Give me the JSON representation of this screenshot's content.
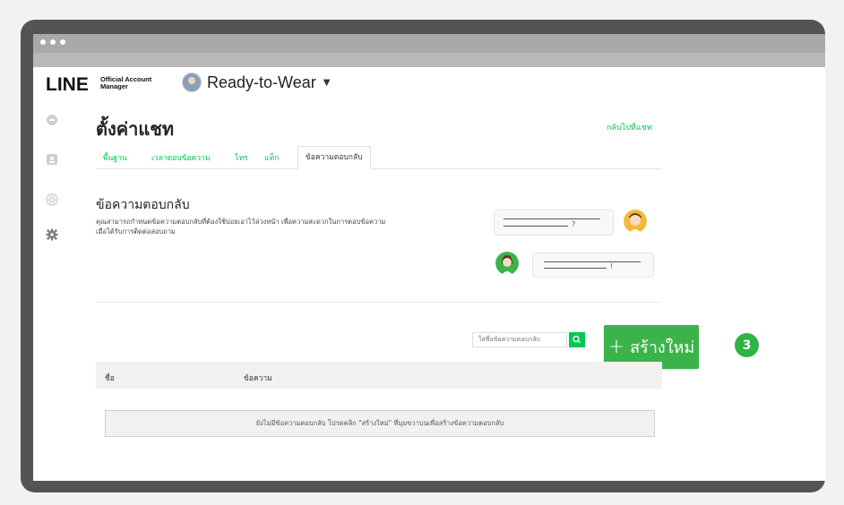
{
  "brand": {
    "line": "LINE",
    "oa_line1": "Official Account",
    "oa_line2": "Manager",
    "account_name": "Ready-to-Wear"
  },
  "page": {
    "title": "ตั้งค่าแชท",
    "back_link": "กลับไปที่แชท"
  },
  "tabs": [
    {
      "label": "พื้นฐาน"
    },
    {
      "label": "เวลาตอบข้อความ"
    },
    {
      "label": "โทร"
    },
    {
      "label": "แท็ก"
    },
    {
      "label": "ข้อความตอบกลับ",
      "active": true
    }
  ],
  "section": {
    "title": "ข้อความตอบกลับ",
    "desc_line1": "คุณสามารถกำหนดข้อความตอบกลับที่ต้องใช้บ่อยเอาไว้ล่วงหน้า เพื่อความสะดวกในการตอบข้อความ",
    "desc_line2": "เมื่อได้รับการติดต่อสอบถาม"
  },
  "illustration": {
    "bubble1_mark": "?",
    "bubble2_mark": "!"
  },
  "search": {
    "placeholder": "ใส่ชื่อข้อความตอบกลับ"
  },
  "create_button": {
    "plus": "+",
    "label": "สร้างใหม่"
  },
  "step_badge": "3",
  "table": {
    "col_name": "ชื่อ",
    "col_message": "ข้อความ",
    "empty_message": "ยังไม่มีข้อความตอบกลับ โปรดคลิก \"สร้างใหม่\" ที่มุมขวาบนเพื่อสร้างข้อความตอบกลับ"
  },
  "colors": {
    "accent": "#06c755",
    "button": "#3cb34a",
    "frame": "#545454"
  }
}
